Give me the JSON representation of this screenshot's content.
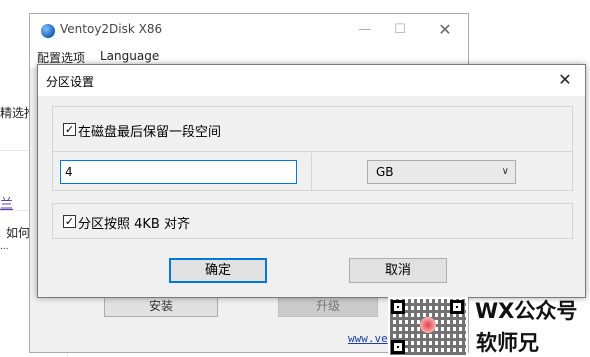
{
  "background_page": {
    "fragments": [
      "精选推",
      "兰",
      "如何",
      "..."
    ]
  },
  "background_window": {
    "title": "Ventoy2Disk  X86",
    "menu": [
      "配置选项",
      "Language"
    ],
    "buttons": [
      "安装",
      "升级"
    ],
    "url_text": "www.ve"
  },
  "dialog": {
    "title": "分区设置",
    "reserve_space": {
      "label": "在磁盘最后保留一段空间",
      "checked": true
    },
    "size_input": {
      "value": "4"
    },
    "unit_select": {
      "value": "GB"
    },
    "align_4kb": {
      "label": "分区按照 4KB 对齐",
      "checked": true
    },
    "ok_label": "确定",
    "cancel_label": "取消"
  },
  "watermark": {
    "line1": "WX公众号",
    "line2": "软师兄"
  },
  "colors": {
    "accent": "#0078d7",
    "dialog_bg": "#f0f0f0",
    "link": "#5b3fa8"
  }
}
